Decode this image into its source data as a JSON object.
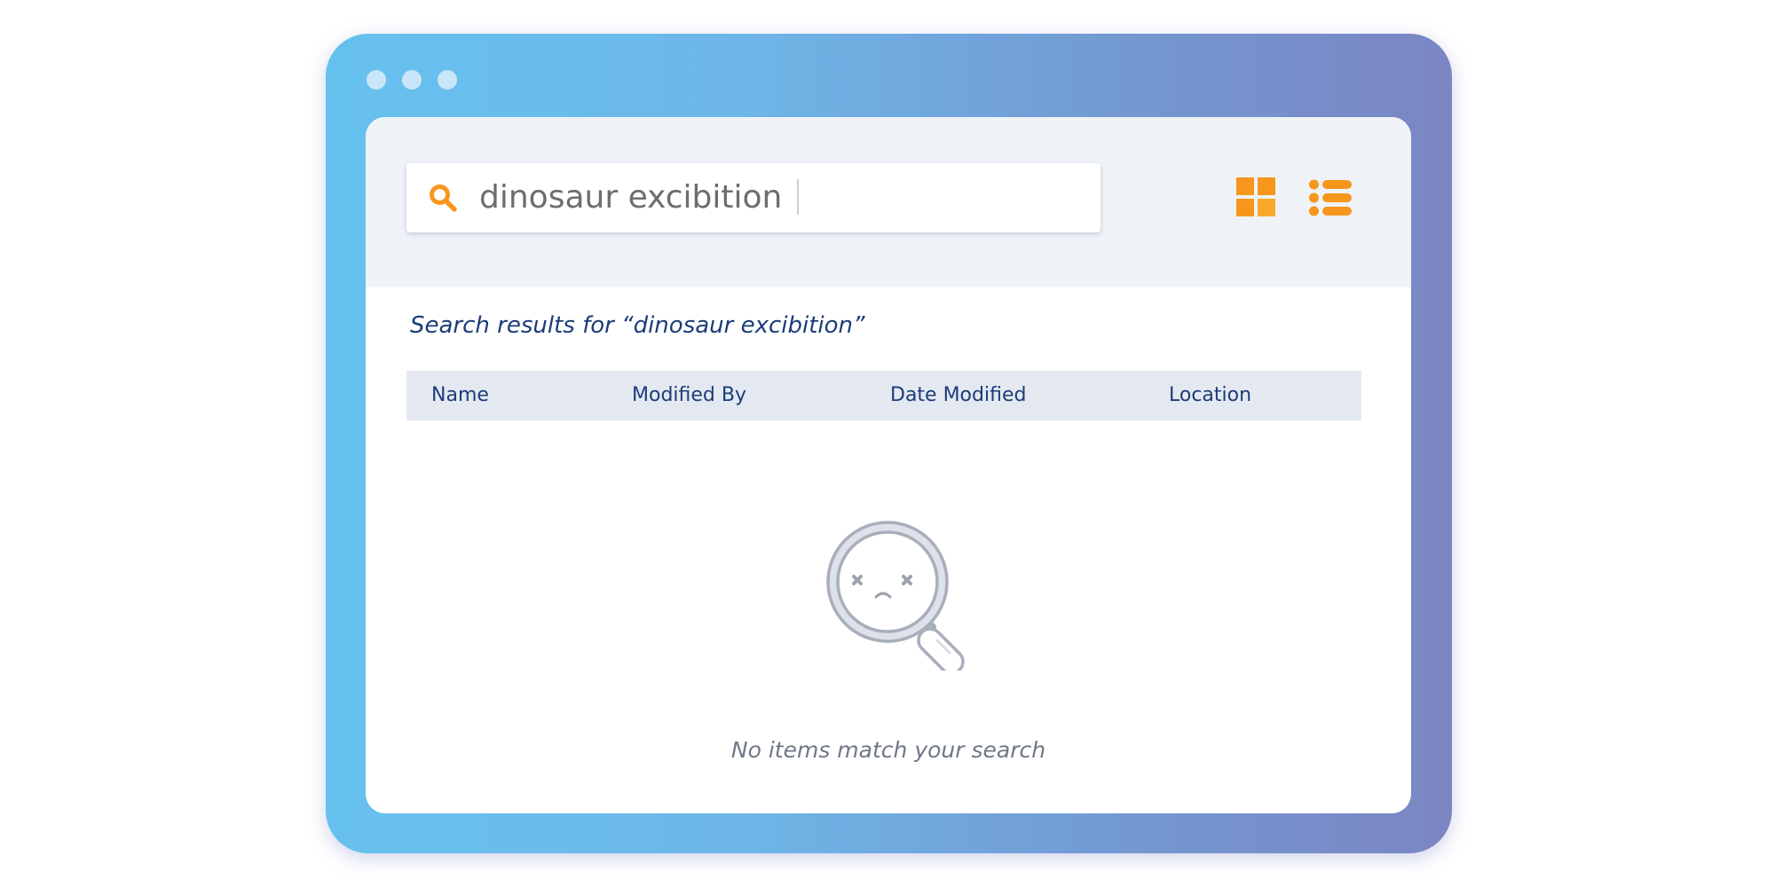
{
  "window": {
    "dots": [
      "dot-1",
      "dot-2",
      "dot-3"
    ]
  },
  "search": {
    "query": "dinosaur excibition",
    "icon": "search-icon"
  },
  "view_toggle": {
    "grid_icon": "grid-view-icon",
    "list_icon": "list-view-icon",
    "accent_color": "#f7961d"
  },
  "results": {
    "heading": "Search results for “dinosaur excibition”",
    "columns": [
      "Name",
      "Modified By",
      "Date Modified",
      "Location"
    ]
  },
  "empty_state": {
    "icon": "sad-magnifier-icon",
    "message": "No items match your search"
  },
  "colors": {
    "title_text": "#1c3c78",
    "header_bg": "#e4e9f1",
    "muted_text": "#707886"
  }
}
